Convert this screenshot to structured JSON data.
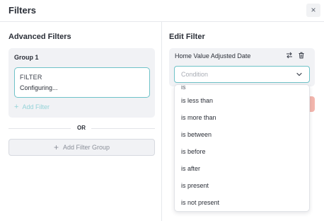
{
  "header": {
    "title": "Filters",
    "close_label": "×"
  },
  "left": {
    "title": "Advanced Filters",
    "group": {
      "title": "Group 1",
      "filter": {
        "label": "FILTER",
        "status": "Configuring..."
      },
      "add_filter_label": "Add Filter"
    },
    "separator_label": "OR",
    "add_group_label": "Add Filter Group"
  },
  "right": {
    "title": "Edit Filter",
    "field_name": "Home Value Adjusted Date",
    "condition_select": {
      "placeholder": "Condition"
    },
    "condition_options": [
      "is",
      "is less than",
      "is more than",
      "is between",
      "is before",
      "is after",
      "is present",
      "is not present"
    ]
  },
  "colors": {
    "accent": "#6fc2c8",
    "accent_light": "#94d3d8",
    "panel_bg": "#f1f2f5",
    "danger_peek": "#f3b6ad"
  },
  "icons": {
    "close": "close-icon",
    "plus": "plus-icon",
    "swap": "swap-arrows-icon",
    "trash": "trash-icon",
    "chevron": "chevron-down-icon"
  }
}
